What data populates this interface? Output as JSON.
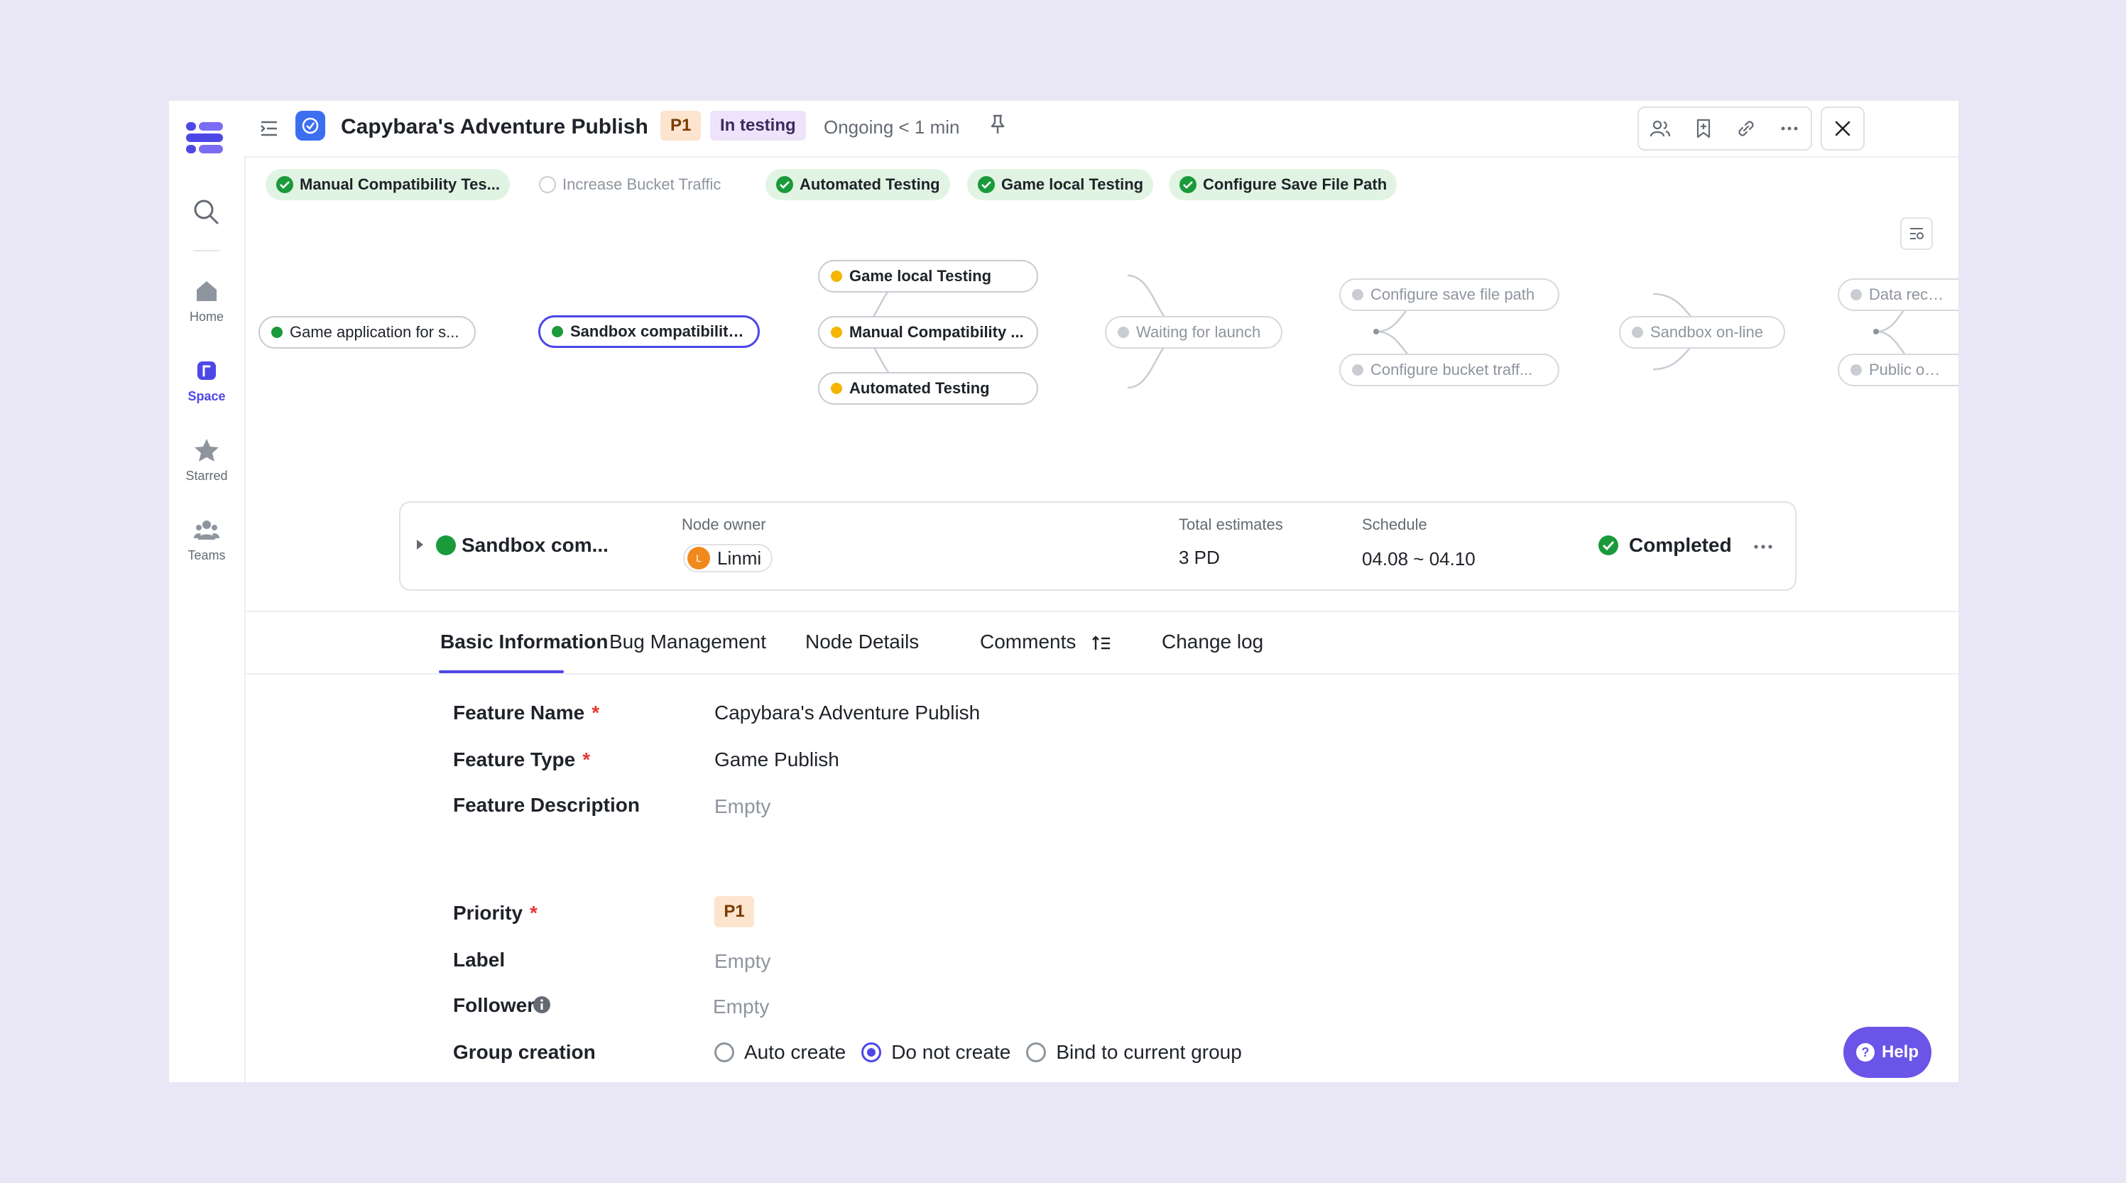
{
  "rail": {
    "items": [
      {
        "label": "Home",
        "icon": "home-icon"
      },
      {
        "label": "Space",
        "icon": "space-icon",
        "active": true
      },
      {
        "label": "Starred",
        "icon": "star-icon"
      },
      {
        "label": "Teams",
        "icon": "teams-icon"
      }
    ]
  },
  "header": {
    "title": "Capybara's Adventure Publish",
    "priority": "P1",
    "status": "In testing",
    "ongoing": "Ongoing < 1 min"
  },
  "chips": [
    {
      "label": "Manual Compatibility Tes...",
      "state": "done"
    },
    {
      "label": "Increase Bucket Traffic",
      "state": "pending"
    },
    {
      "label": "Automated Testing",
      "state": "done"
    },
    {
      "label": "Game local Testing",
      "state": "done"
    },
    {
      "label": "Configure Save File Path",
      "state": "done"
    }
  ],
  "graph": {
    "nodes": [
      {
        "label": "Game application for s...",
        "dot": "#1b9a3b"
      },
      {
        "label": "Sandbox compatibility ...",
        "dot": "#1b9a3b"
      },
      {
        "label": "Game local Testing",
        "dot": "#f5b400"
      },
      {
        "label": "Manual Compatibility ...",
        "dot": "#f5b400"
      },
      {
        "label": "Automated Testing",
        "dot": "#f5b400"
      },
      {
        "label": "Waiting for launch",
        "dot": "#c9ccd3"
      },
      {
        "label": "Configure save file path",
        "dot": "#c9ccd3"
      },
      {
        "label": "Configure bucket traff...",
        "dot": "#c9ccd3"
      },
      {
        "label": "Sandbox on-line",
        "dot": "#c9ccd3"
      },
      {
        "label": "Data recove",
        "dot": "#c9ccd3"
      },
      {
        "label": "Public opini",
        "dot": "#c9ccd3"
      }
    ]
  },
  "node_card": {
    "name": "Sandbox com...",
    "owner_label": "Node owner",
    "owner_initial": "L",
    "owner_name": "Linmi",
    "estimates_label": "Total estimates",
    "estimates_value": "3 PD",
    "schedule_label": "Schedule",
    "schedule_value": "04.08 ~ 04.10",
    "status": "Completed"
  },
  "tabs": [
    "Basic Information",
    "Bug Management",
    "Node Details",
    "Comments",
    "Change log"
  ],
  "form": {
    "feature_name_label": "Feature Name",
    "feature_name_value": "Capybara's Adventure Publish",
    "feature_type_label": "Feature Type",
    "feature_type_value": "Game Publish",
    "feature_description_label": "Feature Description",
    "feature_description_value": "Empty",
    "priority_label": "Priority",
    "priority_value": "P1",
    "label_label": "Label",
    "label_value": "Empty",
    "follower_label": "Follower",
    "follower_value": "Empty",
    "group_creation_label": "Group creation",
    "group_options": [
      {
        "label": "Auto create",
        "checked": false
      },
      {
        "label": "Do not create",
        "checked": true
      },
      {
        "label": "Bind to current group",
        "checked": false
      }
    ],
    "required_mark": "*"
  },
  "help": {
    "label": "Help",
    "icon_glyph": "?"
  },
  "colors": {
    "accent": "#4e47e8",
    "success": "#1b9a3b",
    "warning": "#f5b400",
    "priority_bg": "#fde4cf",
    "status_bg": "#efe3fb"
  }
}
